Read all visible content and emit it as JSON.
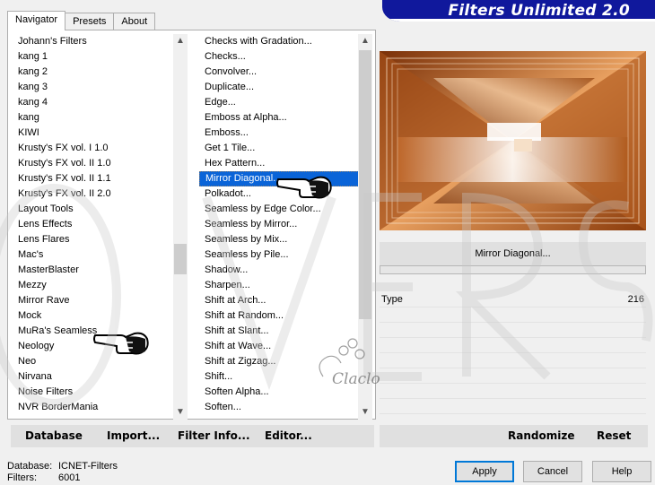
{
  "tabs": [
    "Navigator",
    "Presets",
    "About"
  ],
  "app_title": "Filters Unlimited 2.0",
  "categories": [
    "Johann's Filters",
    "kang 1",
    "kang 2",
    "kang 3",
    "kang 4",
    "kang",
    "KIWI",
    "Krusty's FX vol. I 1.0",
    "Krusty's FX vol. II 1.0",
    "Krusty's FX vol. II 1.1",
    "Krusty's FX vol. II 2.0",
    "Layout Tools",
    "Lens Effects",
    "Lens Flares",
    "Mac's",
    "MasterBlaster",
    "Mezzy",
    "Mirror Rave",
    "Mock",
    "MuRa's Seamless",
    "Neology",
    "Neo",
    "Nirvana",
    "Noise Filters",
    "NVR BorderMania"
  ],
  "filters": [
    "Checks with Gradation...",
    "Checks...",
    "Convolver...",
    "Duplicate...",
    "Edge...",
    "Emboss at Alpha...",
    "Emboss...",
    "Get 1 Tile...",
    "Hex Pattern...",
    "Mirror Diagonal...",
    "Polkadot...",
    "Seamless by Edge Color...",
    "Seamless by Mirror...",
    "Seamless by Mix...",
    "Seamless by Pile...",
    "Shadow...",
    "Sharpen...",
    "Shift at Arch...",
    "Shift at Random...",
    "Shift at Slant...",
    "Shift at Wave...",
    "Shift at Zigzag...",
    "Shift...",
    "Soften Alpha...",
    "Soften..."
  ],
  "selected_filter_index": 9,
  "toolbar": {
    "database": "Database",
    "import": "Import...",
    "filter_info": "Filter Info...",
    "editor": "Editor..."
  },
  "filter_name": "Mirror Diagonal...",
  "param": {
    "name": "Type",
    "value": "216"
  },
  "right_toolbar": {
    "randomize": "Randomize",
    "reset": "Reset"
  },
  "status": {
    "database_label": "Database:",
    "database_value": "ICNET-Filters",
    "filters_label": "Filters:",
    "filters_value": "6001"
  },
  "buttons": {
    "apply": "Apply",
    "cancel": "Cancel",
    "help": "Help"
  },
  "watermark_text": "Claclo",
  "colors": {
    "selection": "#0a64d8",
    "banner": "#10189c",
    "accent": "#0078d7"
  }
}
